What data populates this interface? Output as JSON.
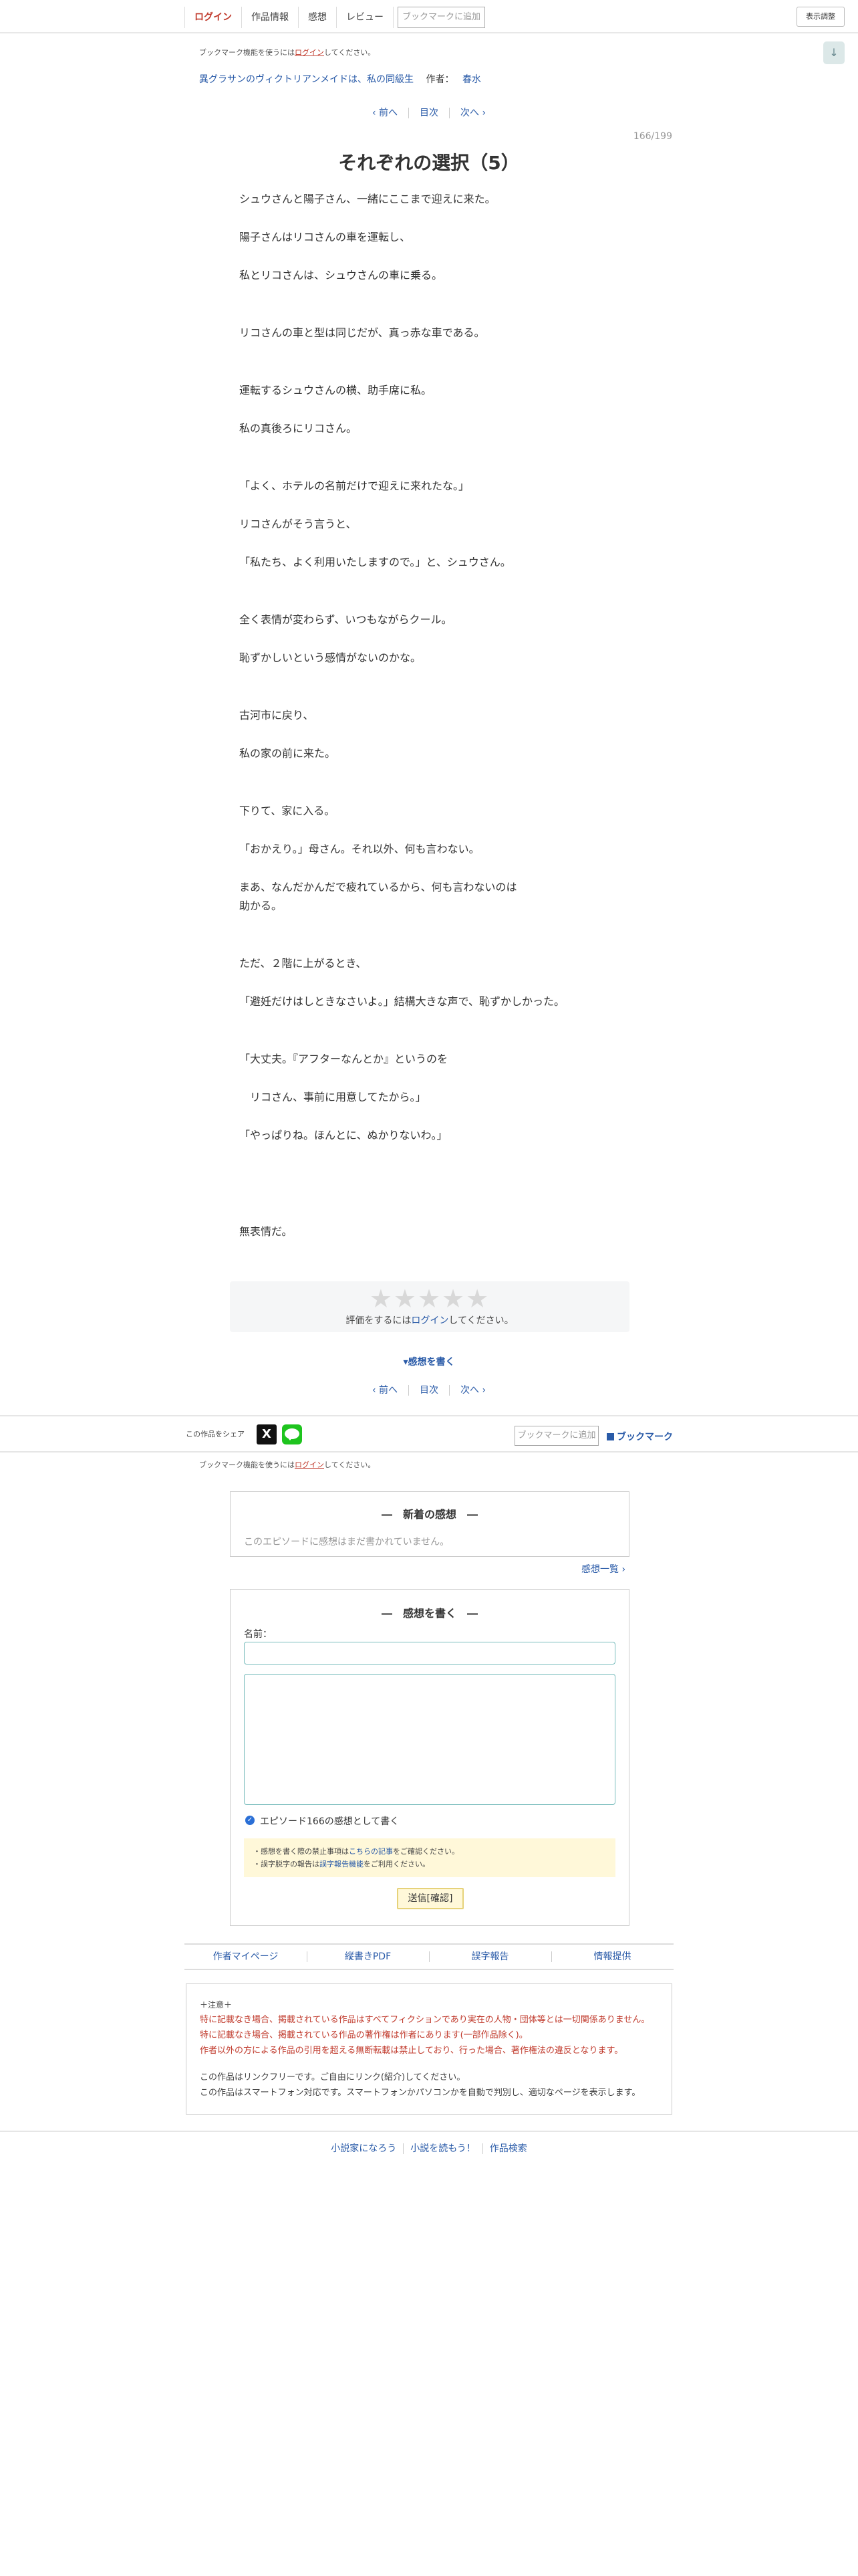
{
  "header": {
    "nav": [
      "ログイン",
      "作品情報",
      "感想",
      "レビュー"
    ],
    "bookmark_button": "ブックマークに追加",
    "display_button": "表示調整",
    "scroll_down_glyph": "↓"
  },
  "bookmark_notice": {
    "prefix": "ブックマーク機能を使うには",
    "link": "ログイン",
    "suffix": "してください。"
  },
  "novel": {
    "title": "異グラサンのヴィクトリアンメイドは、私の同級生",
    "author_label": "作者：",
    "author": "春水"
  },
  "pager": {
    "prev": "‹ 前へ",
    "toc": "目次",
    "next": "次へ ›"
  },
  "page_count": "166/199",
  "episode_title": "それぞれの選択（5）",
  "body_lines": [
    "シュウさんと陽子さん、一緒にここまで迎えに来た。",
    "陽子さんはリコさんの車を運転し、",
    "私とリコさんは、シュウさんの車に乗る。",
    "リコさんの車と型は同じだが、真っ赤な車である。",
    "運転するシュウさんの横、助手席に私。",
    "私の真後ろにリコさん。",
    "「よく、ホテルの名前だけで迎えに来れたな。」",
    "リコさんがそう言うと、",
    "「私たち、よく利用いたしますので。」と、シュウさん。",
    "全く表情が変わらず、いつもながらクール。",
    "恥ずかしいという感情がないのかな。",
    "古河市に戻り、",
    "私の家の前に来た。",
    "下りて、家に入る。",
    "「おかえり。」母さん。それ以外、何も言わない。",
    "まあ、なんだかんだで疲れているから、何も言わないのは",
    "助かる。",
    "ただ、２階に上がるとき、",
    "「避妊だけはしときなさいよ。」結構大きな声で、恥ずかしかった。",
    "「大丈夫。『アフターなんとか』というのを",
    "　リコさん、事前に用意してたから。」",
    "「やっぱりね。ほんとに、ぬかりないわ。」",
    "無表情だ。"
  ],
  "rating": {
    "stars": "★★★★★",
    "note_link": "ログイン",
    "note_prefix": "評価をするには",
    "note_suffix": "してください。"
  },
  "write_impression_link": "▾感想を書く",
  "share": {
    "label": "この作品をシェア",
    "x_glyph": "X",
    "bookmark_button": "ブックマークに追加",
    "bookmark_link": "ブックマーク"
  },
  "latest_impressions": {
    "title": "―　新着の感想　―",
    "empty": "このエピソードに感想はまだ書かれていません。",
    "list_link": "感想一覧 ›"
  },
  "write_form": {
    "title": "―　感想を書く　―",
    "name_label": "名前：",
    "check_label": "エピソード166の感想として書く",
    "check_glyph": "✓",
    "note_1_prefix": "・感想を書く際の禁止事項は",
    "note_1_link": "こちらの記事",
    "note_1_suffix": "をご確認ください。",
    "note_2_prefix": "・誤字脱字の報告は",
    "note_2_link": "誤字報告機能",
    "note_2_suffix": "をご利用ください。",
    "submit": "送信[確認]"
  },
  "footer_links": [
    "作者マイページ",
    "縦書きPDF",
    "誤字報告",
    "情報提供"
  ],
  "caution": {
    "head": "＋注意＋",
    "red_lines": [
      "特に記載なき場合、掲載されている作品はすべてフィクションであり実在の人物・団体等とは一切関係ありません。",
      "特に記載なき場合、掲載されている作品の著作権は作者にあります(一部作品除く)。",
      "作者以外の方による作品の引用を超える無断転載は禁止しており、行った場合、著作権法の違反となります。"
    ],
    "gray_lines": [
      "この作品はリンクフリーです。ご自由にリンク(紹介)してください。",
      "この作品はスマートフォン対応です。スマートフォンかパソコンかを自動で判別し、適切なページを表示します。"
    ]
  },
  "bottom_nav": [
    "小説家になろう",
    "小説を読もう！",
    "作品検索"
  ]
}
